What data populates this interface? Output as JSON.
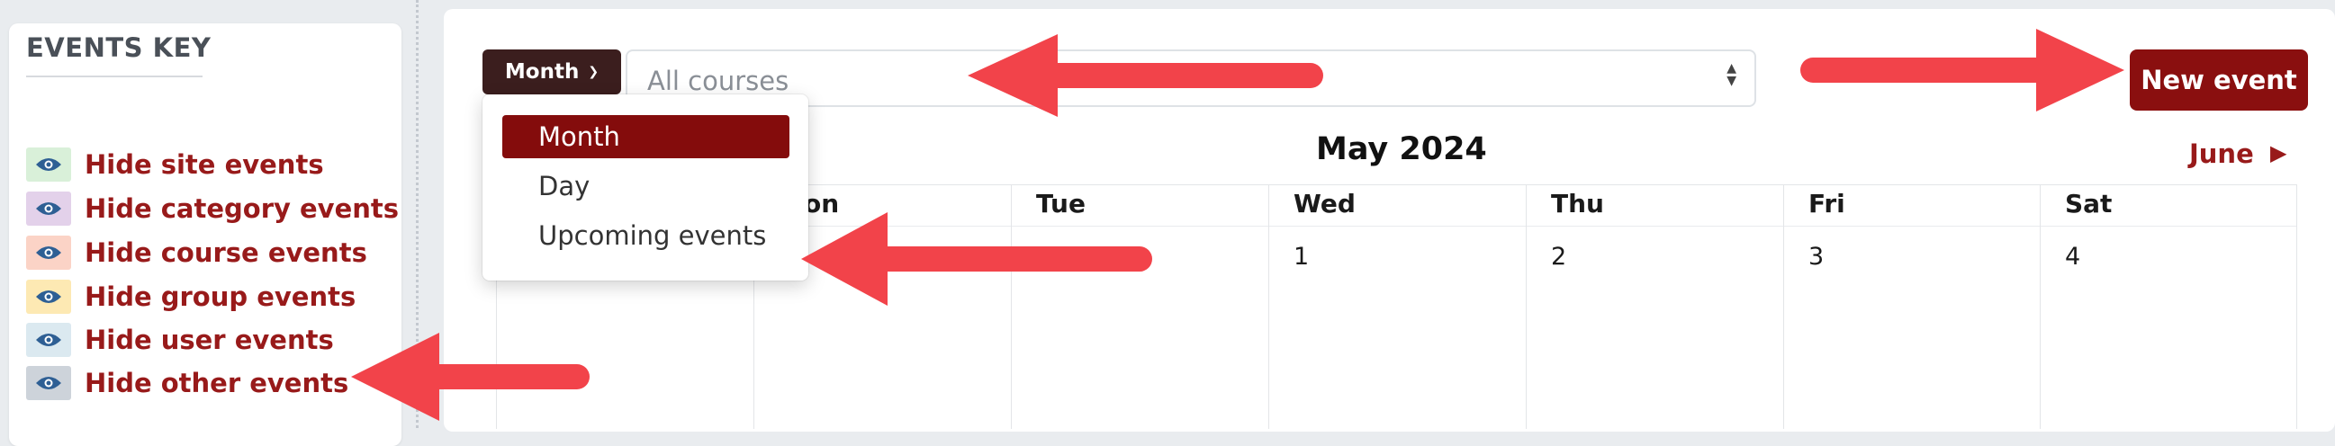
{
  "events_key": {
    "title": "EVENTS KEY",
    "items": [
      {
        "label": "Hide site events",
        "icon": "eye-icon",
        "color": "#d9f0d9"
      },
      {
        "label": "Hide category events",
        "icon": "eye-icon",
        "color": "#e3d1ea"
      },
      {
        "label": "Hide course events",
        "icon": "eye-icon",
        "color": "#fbd3c6"
      },
      {
        "label": "Hide group events",
        "icon": "eye-icon",
        "color": "#fde9b3"
      },
      {
        "label": "Hide user events",
        "icon": "eye-icon",
        "color": "#dbe9f0"
      },
      {
        "label": "Hide other events",
        "icon": "eye-icon",
        "color": "#cdd3da"
      }
    ]
  },
  "toolbar": {
    "view_label": "Month",
    "course_select_value": "All courses",
    "new_event_label": "New event"
  },
  "view_menu": {
    "items": [
      "Month",
      "Day",
      "Upcoming events"
    ],
    "selected": "Month"
  },
  "calendar": {
    "title": "May 2024",
    "next_label": "June",
    "visible_days": [
      {
        "name": "on",
        "num": ""
      },
      {
        "name": "Tue",
        "num": ""
      },
      {
        "name": "Wed",
        "num": "1"
      },
      {
        "name": "Thu",
        "num": "2"
      },
      {
        "name": "Fri",
        "num": "3"
      },
      {
        "name": "Sat",
        "num": "4"
      }
    ]
  },
  "colors": {
    "accent": "#8a0f0f",
    "link": "#981a1a",
    "view_button": "#3b1e1e",
    "annotation_arrow": "#f2434a"
  }
}
